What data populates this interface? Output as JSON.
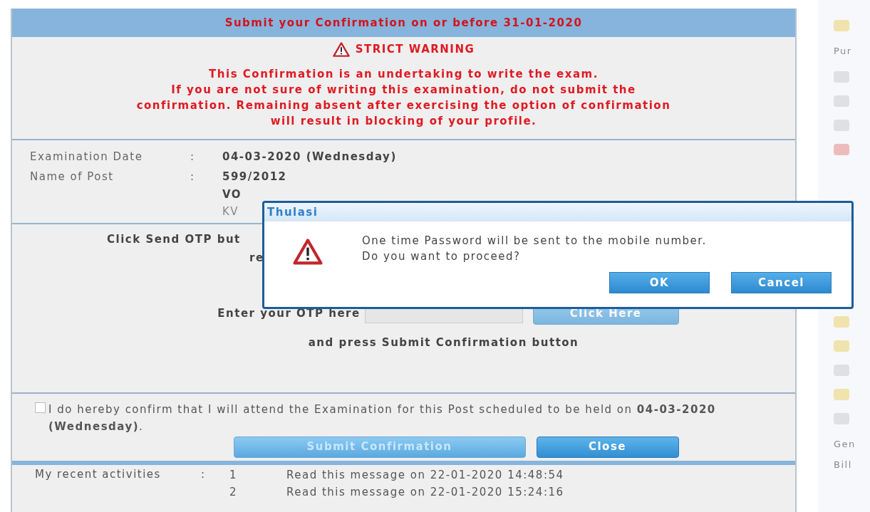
{
  "deadline_banner": "Submit your Confirmation on or before 31-01-2020",
  "warning": {
    "title": "STRICT WARNING",
    "lines": [
      "This Confirmation is an undertaking to write the exam.",
      "If you are not sure of writing this examination, do not submit the",
      "confirmation. Remaining absent after exercising the option of confirmation",
      "will result in blocking of your profile."
    ]
  },
  "details": [
    {
      "label": "Examination Date",
      "separator": ":",
      "values": [
        "04-03-2020 (Wednesday)"
      ]
    },
    {
      "label": "Name of Post",
      "separator": ":",
      "values": [
        "599/2012",
        "VO",
        "KV"
      ]
    }
  ],
  "otp": {
    "instruction_lines": [
      "Click Send OTP but",
      "re"
    ],
    "prompt": "Enter your OTP here",
    "button": "Click Here",
    "after": "and press Submit Confirmation button"
  },
  "confirm": {
    "checked": false,
    "text": "I do hereby confirm that I will attend the Examination for this Post scheduled to be held on **04-03-2020 (Wednesday)**."
  },
  "buttons": [
    {
      "label": "Submit Confirmation",
      "disabled": true
    },
    {
      "label": "Close",
      "disabled": false
    }
  ],
  "recent_activities": {
    "label": "My recent activities",
    "separator": ":",
    "items": [
      {
        "number": "1",
        "text": "Read this message on 22-01-2020 14:48:54"
      },
      {
        "number": "2",
        "text": "Read this message on 22-01-2020 15:24:16"
      }
    ]
  },
  "sidebar": {
    "labels": [
      "Pur",
      "Gen",
      "Bill"
    ]
  },
  "dialog": {
    "title": "Thulasi",
    "message": [
      "One time Password will be sent to the mobile number.",
      "Do you want to proceed?"
    ],
    "buttons": [
      "OK",
      "Cancel"
    ]
  }
}
